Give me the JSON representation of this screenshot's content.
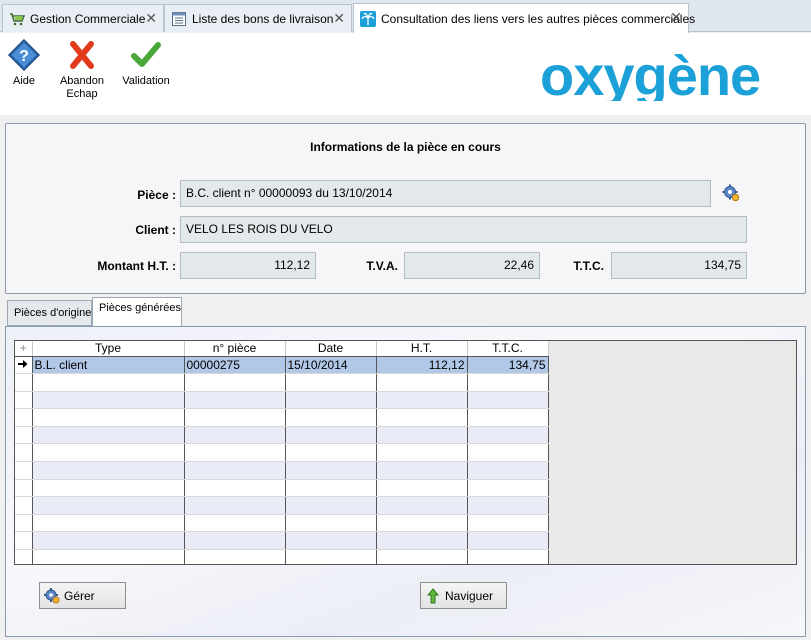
{
  "tabs": [
    {
      "label": "Gestion Commerciale",
      "icon": "cart-icon",
      "active": false
    },
    {
      "label": "Liste des bons de livraison",
      "icon": "list-icon",
      "active": false
    },
    {
      "label": "Consultation des liens vers les autres pièces commerciales",
      "icon": "palm-icon",
      "active": true
    }
  ],
  "toolbar": {
    "help_label": "Aide",
    "cancel_label_1": "Abandon",
    "cancel_label_2": "Echap",
    "validate_label": "Validation"
  },
  "brand": {
    "logo": "oxygène",
    "accent": "#1ba0d8"
  },
  "info": {
    "title": "Informations de la pièce en cours",
    "piece_label": "Pièce :",
    "piece_value": "B.C. client n° 00000093 du 13/10/2014",
    "client_label": "Client :",
    "client_value": "VELO LES ROIS DU VELO",
    "ht_label": "Montant H.T. :",
    "ht_value": "112,12",
    "tva_label": "T.V.A.",
    "tva_value": "22,46",
    "ttc_label": "T.T.C.",
    "ttc_value": "134,75"
  },
  "subtabs": {
    "origin_label": "Pièces d'origine",
    "generated_label": "Pièces générées"
  },
  "grid": {
    "columns": [
      "Type",
      "n° pièce",
      "Date",
      "H.T.",
      "T.T.C."
    ],
    "rows": [
      {
        "type": "B.L. client",
        "num": "00000275",
        "date": "15/10/2014",
        "ht": "112,12",
        "ttc": "134,75"
      }
    ]
  },
  "buttons": {
    "manage_label": "Gérer",
    "navigate_label": "Naviguer"
  }
}
